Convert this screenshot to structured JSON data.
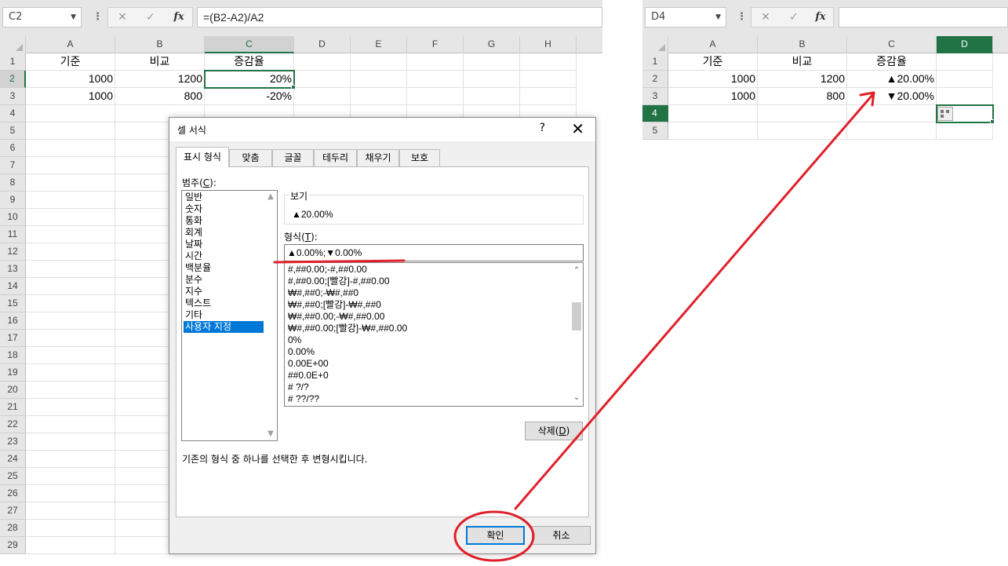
{
  "left_sheet": {
    "name_box": "C2",
    "formula": "=(B2-A2)/A2",
    "formula_buttons": {
      "cancel": "✕",
      "enter": "✓",
      "fx": "fx"
    },
    "columns": [
      "A",
      "B",
      "C",
      "D",
      "E",
      "F",
      "G",
      "H"
    ],
    "rows": [
      "1",
      "2",
      "3",
      "4",
      "5",
      "6",
      "7",
      "8",
      "9",
      "10",
      "11",
      "12",
      "13",
      "14",
      "15",
      "16",
      "17",
      "18",
      "19",
      "20",
      "21",
      "22",
      "23",
      "24",
      "25",
      "26",
      "27",
      "28",
      "29"
    ],
    "cells": {
      "A1": "기준",
      "B1": "비교",
      "C1": "증감율",
      "A2": "1000",
      "B2": "1200",
      "C2": "20%",
      "A3": "1000",
      "B3": "800",
      "C3": "-20%"
    }
  },
  "right_sheet": {
    "name_box": "D4",
    "formula": "",
    "formula_buttons": {
      "cancel": "✕",
      "enter": "✓",
      "fx": "fx"
    },
    "columns": [
      "A",
      "B",
      "C",
      "D"
    ],
    "rows": [
      "1",
      "2",
      "3",
      "4",
      "5"
    ],
    "cells": {
      "A1": "기준",
      "B1": "비교",
      "C1": "증감율",
      "A2": "1000",
      "B2": "1200",
      "C2": "▲20.00%",
      "A3": "1000",
      "B3": "800",
      "C3": "▼20.00%"
    }
  },
  "dialog": {
    "title": "셀 서식",
    "help": "?",
    "close": "✕",
    "tabs": [
      "표시 형식",
      "맞춤",
      "글꼴",
      "테두리",
      "채우기",
      "보호"
    ],
    "category_label": "범주(",
    "category_hotkey": "C",
    "category_label_end": "):",
    "categories": [
      "일반",
      "숫자",
      "통화",
      "회계",
      "날짜",
      "시간",
      "백분율",
      "분수",
      "지수",
      "텍스트",
      "기타",
      "사용자 지정"
    ],
    "selected_category": "사용자 지정",
    "preview_label": "보기",
    "preview_value": "▲20.00%",
    "format_label": "형식(",
    "format_hotkey": "T",
    "format_label_end": "):",
    "format_value": "▲0.00%;▼0.00%",
    "format_list": [
      "#,##0.00;-#,##0.00",
      "#,##0.00;[빨강]-#,##0.00",
      "₩#,##0;-₩#,##0",
      "₩#,##0;[빨강]-₩#,##0",
      "₩#,##0.00;-₩#,##0.00",
      "₩#,##0.00;[빨강]-₩#,##0.00",
      "0%",
      "0.00%",
      "0.00E+00",
      "##0.0E+0",
      "# ?/?",
      "# ??/??"
    ],
    "delete_button": "삭제(",
    "delete_hotkey": "D",
    "delete_end": ")",
    "description": "기존의 형식 중 하나를 선택한 후 변형시킵니다.",
    "ok_button": "확인",
    "cancel_button": "취소"
  },
  "colors": {
    "excel_green": "#217346",
    "selection_blue": "#0078d7",
    "annotation_red": "#e0202a"
  }
}
